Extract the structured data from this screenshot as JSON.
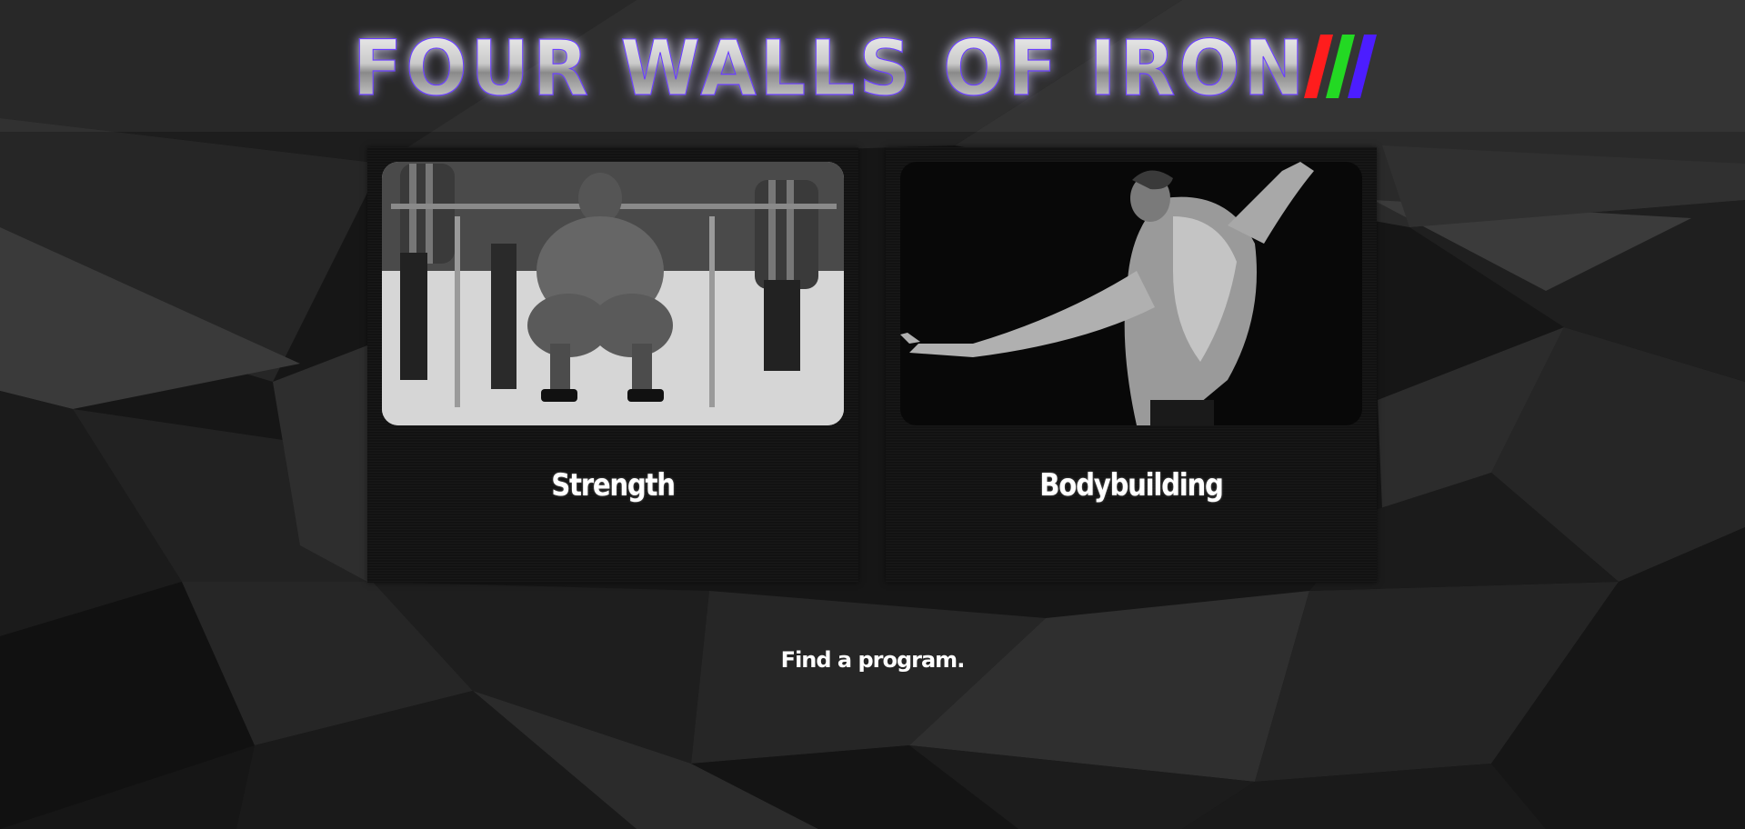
{
  "header": {
    "title": "FOUR WALLS OF IRON",
    "slash_colors": [
      "#ff1d1d",
      "#23d923",
      "#4c1dff"
    ],
    "glow_color": "#5a2cff"
  },
  "cards": [
    {
      "title": "Strength",
      "image_subject": "squat-lift-photo"
    },
    {
      "title": "Bodybuilding",
      "image_subject": "bodybuilder-pose-photo"
    }
  ],
  "tagline": "Find a program."
}
